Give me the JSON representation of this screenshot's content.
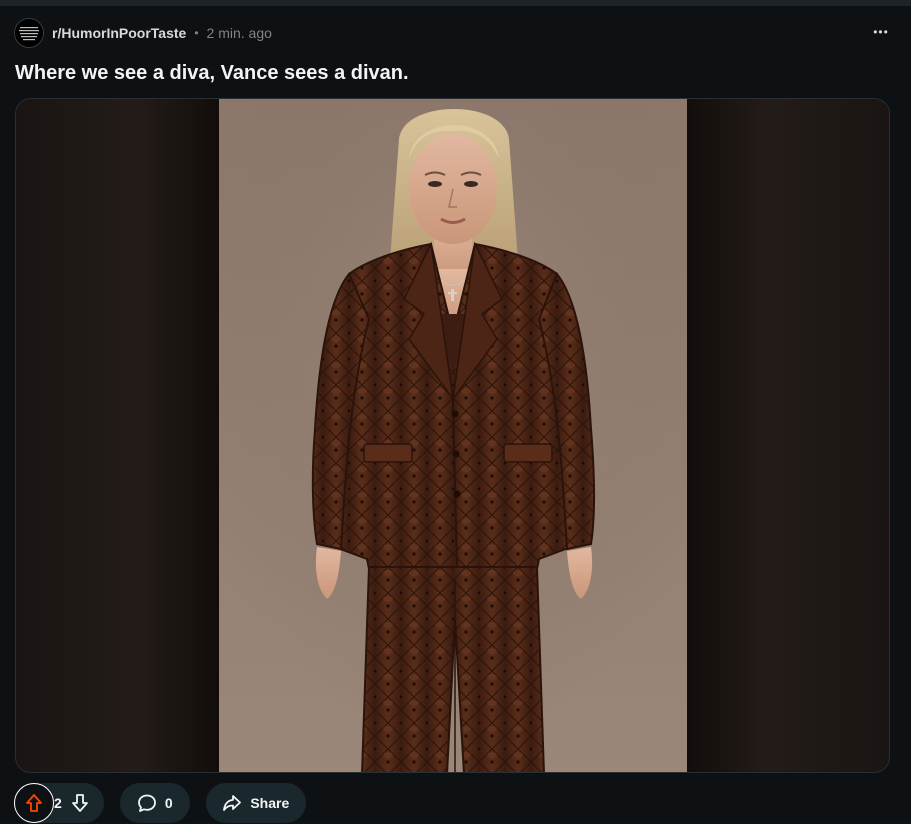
{
  "post": {
    "subreddit": "r/HumorInPoorTaste",
    "separator": "•",
    "time_ago": "2 min. ago",
    "menu_label": "•••",
    "title": "Where we see a diva, Vance sees a divan."
  },
  "actions": {
    "vote_count": "2",
    "comment_count": "0",
    "share_label": "Share"
  },
  "colors": {
    "upvote_accent": "#ff4500",
    "pill_background": "#1a282d"
  }
}
